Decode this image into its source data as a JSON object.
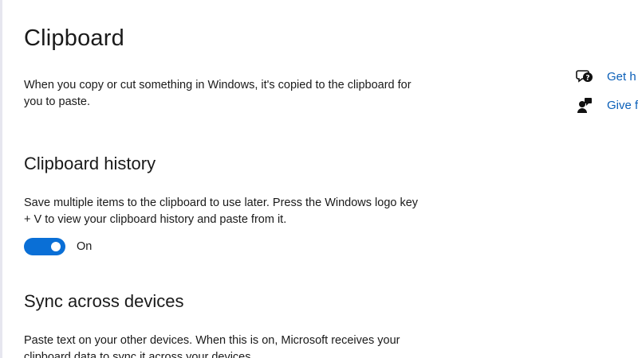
{
  "page": {
    "title": "Clipboard",
    "intro": "When you copy or cut something in Windows, it's copied to the clipboard for you to paste."
  },
  "history": {
    "title": "Clipboard history",
    "description": "Save multiple items to the clipboard to use later. Press the Windows logo key + V to view your clipboard history and paste from it.",
    "toggle_state": "On",
    "toggle_on": true
  },
  "sync": {
    "title": "Sync across devices",
    "description": "Paste text on your other devices. When this is on, Microsoft receives your clipboard data to sync it across your devices."
  },
  "side_links": {
    "get_help": "Get h",
    "give_feedback": "Give f",
    "get_help_icon": "help-chat-icon",
    "feedback_icon": "feedback-person-icon"
  },
  "colors": {
    "accent": "#0a6fd6",
    "link": "#0a5fb8"
  }
}
